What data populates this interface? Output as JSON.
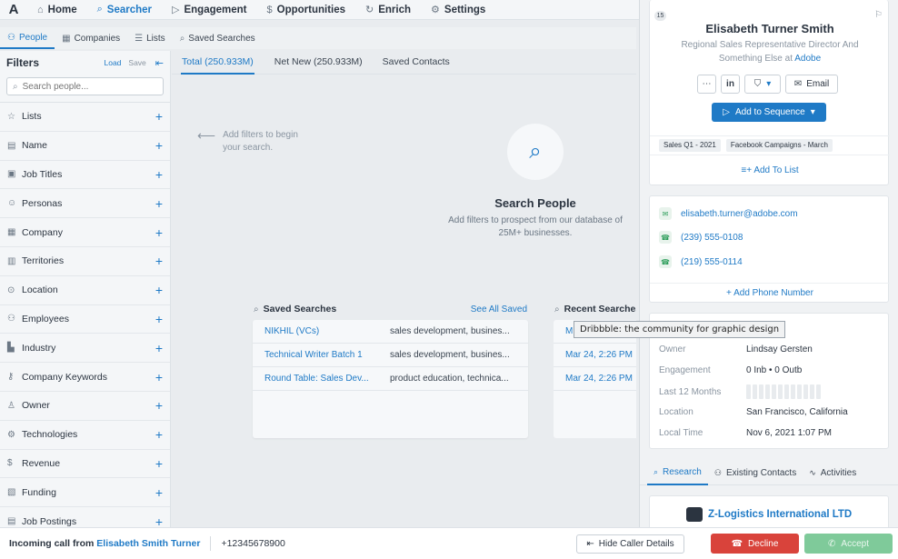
{
  "topnav": {
    "logo": "A",
    "items": [
      {
        "label": "Home",
        "icon": "home-icon",
        "glyph": "⌂"
      },
      {
        "label": "Searcher",
        "icon": "search-icon",
        "glyph": "⌕"
      },
      {
        "label": "Engagement",
        "icon": "send-icon",
        "glyph": "▷"
      },
      {
        "label": "Opportunities",
        "icon": "dollar-icon",
        "glyph": "$"
      },
      {
        "label": "Enrich",
        "icon": "refresh-icon",
        "glyph": "↻"
      },
      {
        "label": "Settings",
        "icon": "gear-icon",
        "glyph": "⚙"
      }
    ]
  },
  "subnav": {
    "items": [
      {
        "label": "People",
        "icon": "people-icon",
        "glyph": "⚇"
      },
      {
        "label": "Companies",
        "icon": "building-icon",
        "glyph": "▦"
      },
      {
        "label": "Lists",
        "icon": "list-icon",
        "glyph": "☰"
      },
      {
        "label": "Saved Searches",
        "icon": "search-icon",
        "glyph": "⌕"
      }
    ]
  },
  "filters": {
    "title": "Filters",
    "load": "Load",
    "save": "Save",
    "search_placeholder": "Search people...",
    "items": [
      {
        "label": "Lists",
        "icon": "star-icon",
        "glyph": "☆"
      },
      {
        "label": "Name",
        "icon": "id-card-icon",
        "glyph": "▤"
      },
      {
        "label": "Job Titles",
        "icon": "briefcase-icon",
        "glyph": "▣"
      },
      {
        "label": "Personas",
        "icon": "persona-icon",
        "glyph": "☺"
      },
      {
        "label": "Company",
        "icon": "building-icon",
        "glyph": "▦"
      },
      {
        "label": "Territories",
        "icon": "map-icon",
        "glyph": "▥"
      },
      {
        "label": "Location",
        "icon": "location-pin-icon",
        "glyph": "⊙"
      },
      {
        "label": "Employees",
        "icon": "people-icon",
        "glyph": "⚇"
      },
      {
        "label": "Industry",
        "icon": "factory-icon",
        "glyph": "▙"
      },
      {
        "label": "Company Keywords",
        "icon": "key-icon",
        "glyph": "⚷"
      },
      {
        "label": "Owner",
        "icon": "user-icon",
        "glyph": "♙"
      },
      {
        "label": "Technologies",
        "icon": "tech-icon",
        "glyph": "⚙"
      },
      {
        "label": "Revenue",
        "icon": "dollar-icon",
        "glyph": "$"
      },
      {
        "label": "Funding",
        "icon": "funding-icon",
        "glyph": "▧"
      },
      {
        "label": "Job Postings",
        "icon": "posting-icon",
        "glyph": "▤"
      }
    ]
  },
  "main": {
    "tabs": [
      "Total (250.933M)",
      "Net New (250.933M)",
      "Saved Contacts"
    ],
    "hint": "Add filters to begin your search.",
    "empty_title": "Search People",
    "empty_sub": "Add filters to prospect from our database of 25M+ businesses.",
    "saved_searches": {
      "title": "Saved Searches",
      "see_all": "See All Saved",
      "rows": [
        {
          "name": "NIKHIL (VCs)",
          "desc": "sales development, busines..."
        },
        {
          "name": "Technical Writer Batch 1",
          "desc": "sales development, busines..."
        },
        {
          "name": "Round Table: Sales Dev...",
          "desc": "product education, technica..."
        }
      ]
    },
    "recent_searches": {
      "title": "Recent Searches",
      "rows": [
        "M",
        "Mar 24, 2:26 PM",
        "Mar 24, 2:26 PM"
      ]
    }
  },
  "tooltip": "Dribbble: the community for graphic design",
  "panel": {
    "badge": "15",
    "name": "Elisabeth Turner Smith",
    "title": "Regional Sales Representative Director And Something Else at",
    "company_link": "Adobe",
    "email_button": "Email",
    "sequence_button": "Add to Sequence",
    "tags": [
      "Sales Q1 - 2021",
      "Facebook Campaigns - March"
    ],
    "add_to_list": "Add To List",
    "contacts": {
      "email": "elisabeth.turner@adobe.com",
      "phone1": "(239) 555-0108",
      "phone2": "(219) 555-0114",
      "add_phone": "Add Phone Number"
    },
    "details": {
      "owner_label": "Owner",
      "owner": "Lindsay Gersten",
      "engagement_label": "Engagement",
      "engagement": "0 Inb  •  0 Outb",
      "months_label": "Last 12 Months",
      "location_label": "Location",
      "location": "San Francisco, California",
      "time_label": "Local Time",
      "time": "Nov 6, 2021 1:07 PM"
    },
    "tabs": [
      "Research",
      "Existing Contacts",
      "Activities"
    ],
    "company": "Z-Logistics International LTD"
  },
  "callbar": {
    "prefix": "Incoming call from",
    "caller": "Elisabeth Smith Turner",
    "number": "+12345678900",
    "hide": "Hide Caller Details",
    "decline": "Decline",
    "accept": "Accept"
  },
  "colors": {
    "accent": "#1f7ac6",
    "decline": "#d9433b",
    "accept": "#7fca9a"
  }
}
